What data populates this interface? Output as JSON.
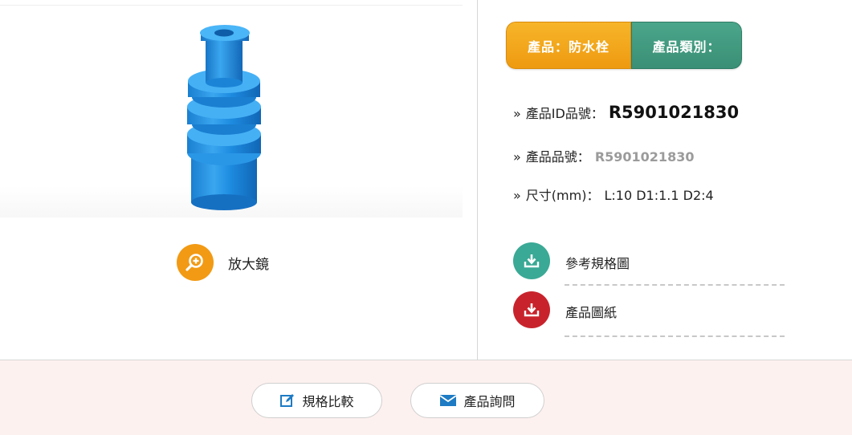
{
  "gallery": {
    "magnifier_label": "放大鏡",
    "magnifier_color": "#f29a14"
  },
  "tabs": {
    "product": "產品：防水栓",
    "category": "產品類別："
  },
  "specs": {
    "bullet": "»",
    "id_label": "產品ID品號：",
    "id_value": "R5901021830",
    "part_label": "產品品號：",
    "part_value": "R5901021830",
    "size_label": "尺寸(mm)：",
    "size_value": "L:10 D1:1.1 D2:4"
  },
  "downloads": [
    {
      "label": "參考規格圖",
      "icon": "download-tray-icon",
      "color": "#3aa995"
    },
    {
      "label": "產品圖紙",
      "icon": "download-tray-icon",
      "color": "#c8232c"
    }
  ],
  "footer": {
    "compare_label": "規格比較",
    "inquiry_label": "產品詢問",
    "icon_color": "#1e7bc4",
    "background": "#fdf1ef"
  }
}
